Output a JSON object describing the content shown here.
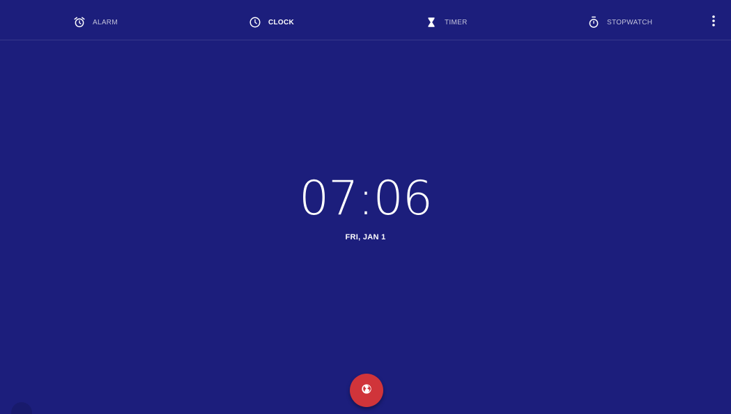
{
  "tabs": [
    {
      "label": "ALARM",
      "icon": "alarm-icon",
      "active": false
    },
    {
      "label": "CLOCK",
      "icon": "clock-icon",
      "active": true
    },
    {
      "label": "TIMER",
      "icon": "hourglass-icon",
      "active": false
    },
    {
      "label": "STOPWATCH",
      "icon": "stopwatch-icon",
      "active": false
    }
  ],
  "overflow_icon": "more-vert-icon",
  "clock": {
    "time": "07:06",
    "date": "FRI, JAN 1"
  },
  "fab": {
    "icon": "globe-icon"
  },
  "colors": {
    "background": "#1c1e7c",
    "fab": "#d0343a",
    "text": "#ffffff"
  }
}
